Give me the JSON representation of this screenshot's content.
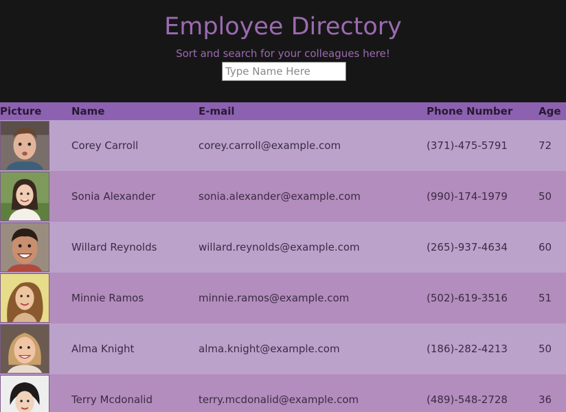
{
  "header": {
    "title": "Employee Directory",
    "subtitle": "Sort and search for your colleagues here!",
    "search_placeholder": "Type Name Here",
    "search_value": ""
  },
  "table": {
    "columns": [
      "Picture",
      "Name",
      "E-mail",
      "Phone Number",
      "Age"
    ],
    "rows": [
      {
        "name": "Corey Carroll",
        "email": "corey.carroll@example.com",
        "phone": "(371)-475-5791",
        "age": "72"
      },
      {
        "name": "Sonia Alexander",
        "email": "sonia.alexander@example.com",
        "phone": "(990)-174-1979",
        "age": "50"
      },
      {
        "name": "Willard Reynolds",
        "email": "willard.reynolds@example.com",
        "phone": "(265)-937-4634",
        "age": "60"
      },
      {
        "name": "Minnie Ramos",
        "email": "minnie.ramos@example.com",
        "phone": "(502)-619-3516",
        "age": "51"
      },
      {
        "name": "Alma Knight",
        "email": "alma.knight@example.com",
        "phone": "(186)-282-4213",
        "age": "50"
      },
      {
        "name": "Terry Mcdonalid",
        "email": "terry.mcdonalid@example.com",
        "phone": "(489)-548-2728",
        "age": "36"
      }
    ]
  },
  "colors": {
    "title": "#9b6bb0",
    "header_row": "#8c62b0",
    "row_odd": "#bba2cb",
    "row_even": "#b38dbd"
  }
}
